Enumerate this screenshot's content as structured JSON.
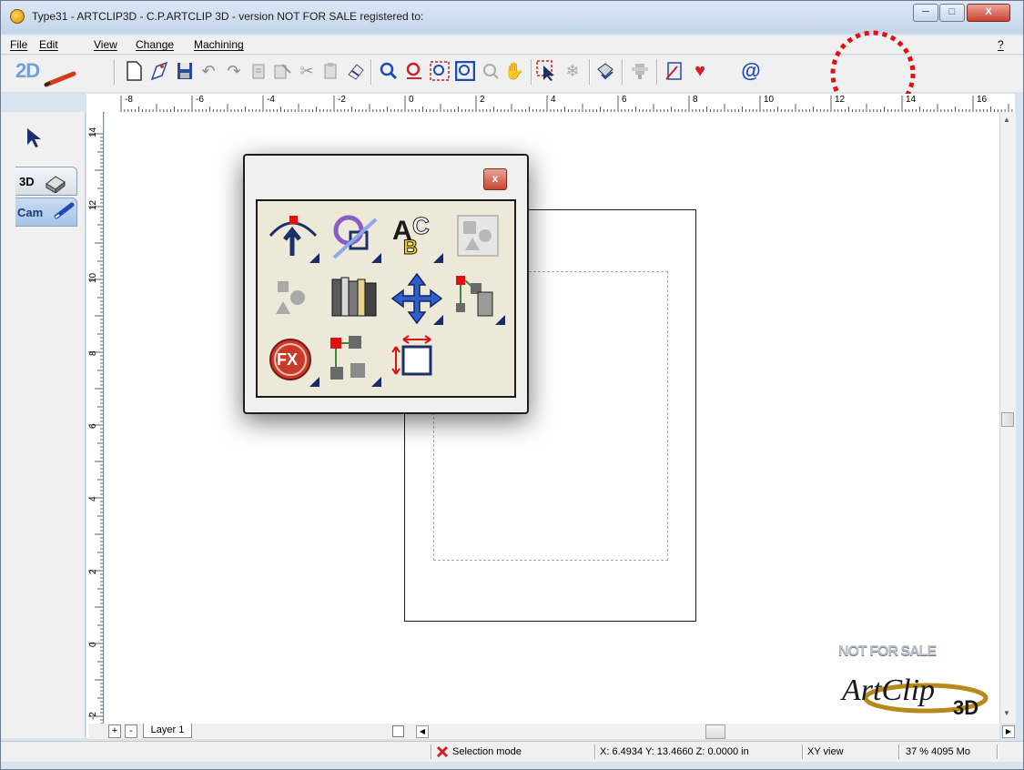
{
  "window": {
    "title": "Type31 - ARTCLIP3D  - C.P.ARTCLIP 3D - version NOT FOR SALE registered to:",
    "buttons": [
      "─",
      "□",
      "X"
    ]
  },
  "menu": {
    "items": [
      "File",
      "Edit",
      "View",
      "Change",
      "Machining"
    ],
    "help": "?"
  },
  "toolbar": {
    "mode_label": "2D",
    "icons": [
      "new-document-icon",
      "open-icon",
      "save-icon",
      "undo-icon",
      "redo-icon",
      "copy-icon",
      "paste-icon",
      "cut-icon",
      "clipboard-icon",
      "eraser-icon",
      "zoom-in-icon",
      "zoom-out-icon",
      "zoom-fit-icon",
      "zoom-window-icon",
      "zoom-disabled-icon",
      "pan-hand-icon",
      "select-arrow-icon",
      "snowflake-icon",
      "print-icon",
      "tool-disabled-icon",
      "notes-icon",
      "heart-icon",
      "at-sign-icon"
    ]
  },
  "ruler": {
    "horizontal": [
      "-8",
      "-6",
      "-4",
      "-2",
      "0",
      "2",
      "4",
      "6",
      "8",
      "10",
      "12",
      "14",
      "16"
    ],
    "vertical": [
      "14",
      "12",
      "10",
      "8",
      "6",
      "4",
      "2",
      "0",
      "-2"
    ]
  },
  "sidebar": {
    "tabs": [
      "3D",
      "Cam"
    ]
  },
  "palette": {
    "close": "x",
    "tools": [
      "curve-node-icon",
      "shape-circle-square-icon",
      "text-abc-icon",
      "primitives-disabled-icon",
      "primitives-icon",
      "library-books-icon",
      "move-cross-arrows-icon",
      "hierarchy-3d-icon",
      "fx-effects-icon",
      "hierarchy-nodes-icon",
      "resize-frame-icon"
    ],
    "fx_label": "FX"
  },
  "layer": {
    "add": "+",
    "remove": "-",
    "name": "Layer 1"
  },
  "status": {
    "mode": "Selection mode",
    "coords": "X: 6.4934   Y: 13.4660   Z: 0.0000 in",
    "view": "XY view",
    "memory": "37 % 4095 Mo"
  },
  "watermark": {
    "line": "NOT FOR SALE"
  },
  "colors": {
    "highlight_circle": "#e01010",
    "heart": "#d8202a",
    "palette_triangle": "#1a2a6a"
  }
}
